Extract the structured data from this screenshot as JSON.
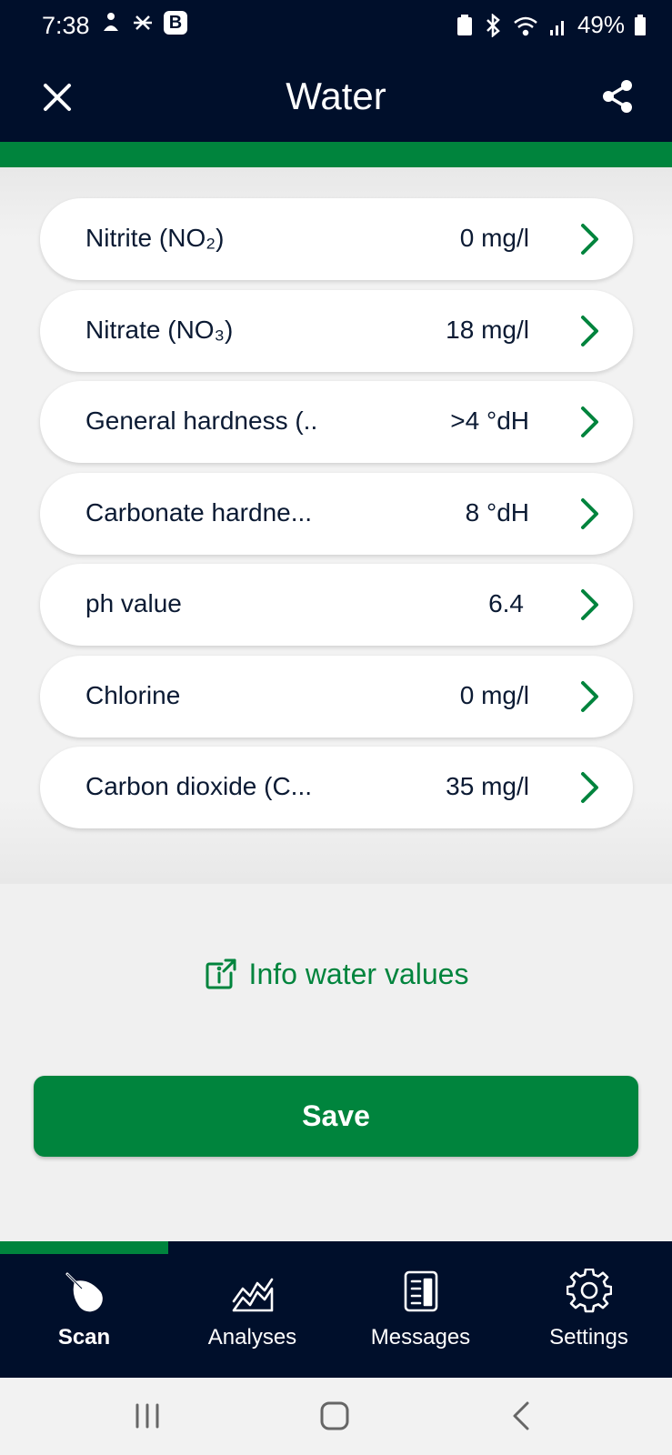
{
  "status_bar": {
    "time": "7:38",
    "battery": "49%"
  },
  "header": {
    "title": "Water"
  },
  "parameters": [
    {
      "label": "Nitrite (NO₂)",
      "value": "0 mg/l"
    },
    {
      "label": "Nitrate (NO₃)",
      "value": "18 mg/l"
    },
    {
      "label": "General hardness (..",
      "value": ">4 °dH"
    },
    {
      "label": "Carbonate hardne...",
      "value": "8 °dH"
    },
    {
      "label": "ph value",
      "value": "6.4"
    },
    {
      "label": "Chlorine",
      "value": "0 mg/l"
    },
    {
      "label": "Carbon dioxide (C...",
      "value": "35 mg/l"
    }
  ],
  "info_link": {
    "label": "Info water values"
  },
  "save_button": {
    "label": "Save"
  },
  "bottom_nav": {
    "items": [
      {
        "label": "Scan",
        "icon": "scan-drop-icon",
        "active": true
      },
      {
        "label": "Analyses",
        "icon": "chart-icon",
        "active": false
      },
      {
        "label": "Messages",
        "icon": "news-icon",
        "active": false
      },
      {
        "label": "Settings",
        "icon": "gear-icon",
        "active": false
      }
    ]
  },
  "colors": {
    "navy": "#000f2b",
    "green": "#00843d",
    "text": "#0b1a33"
  }
}
